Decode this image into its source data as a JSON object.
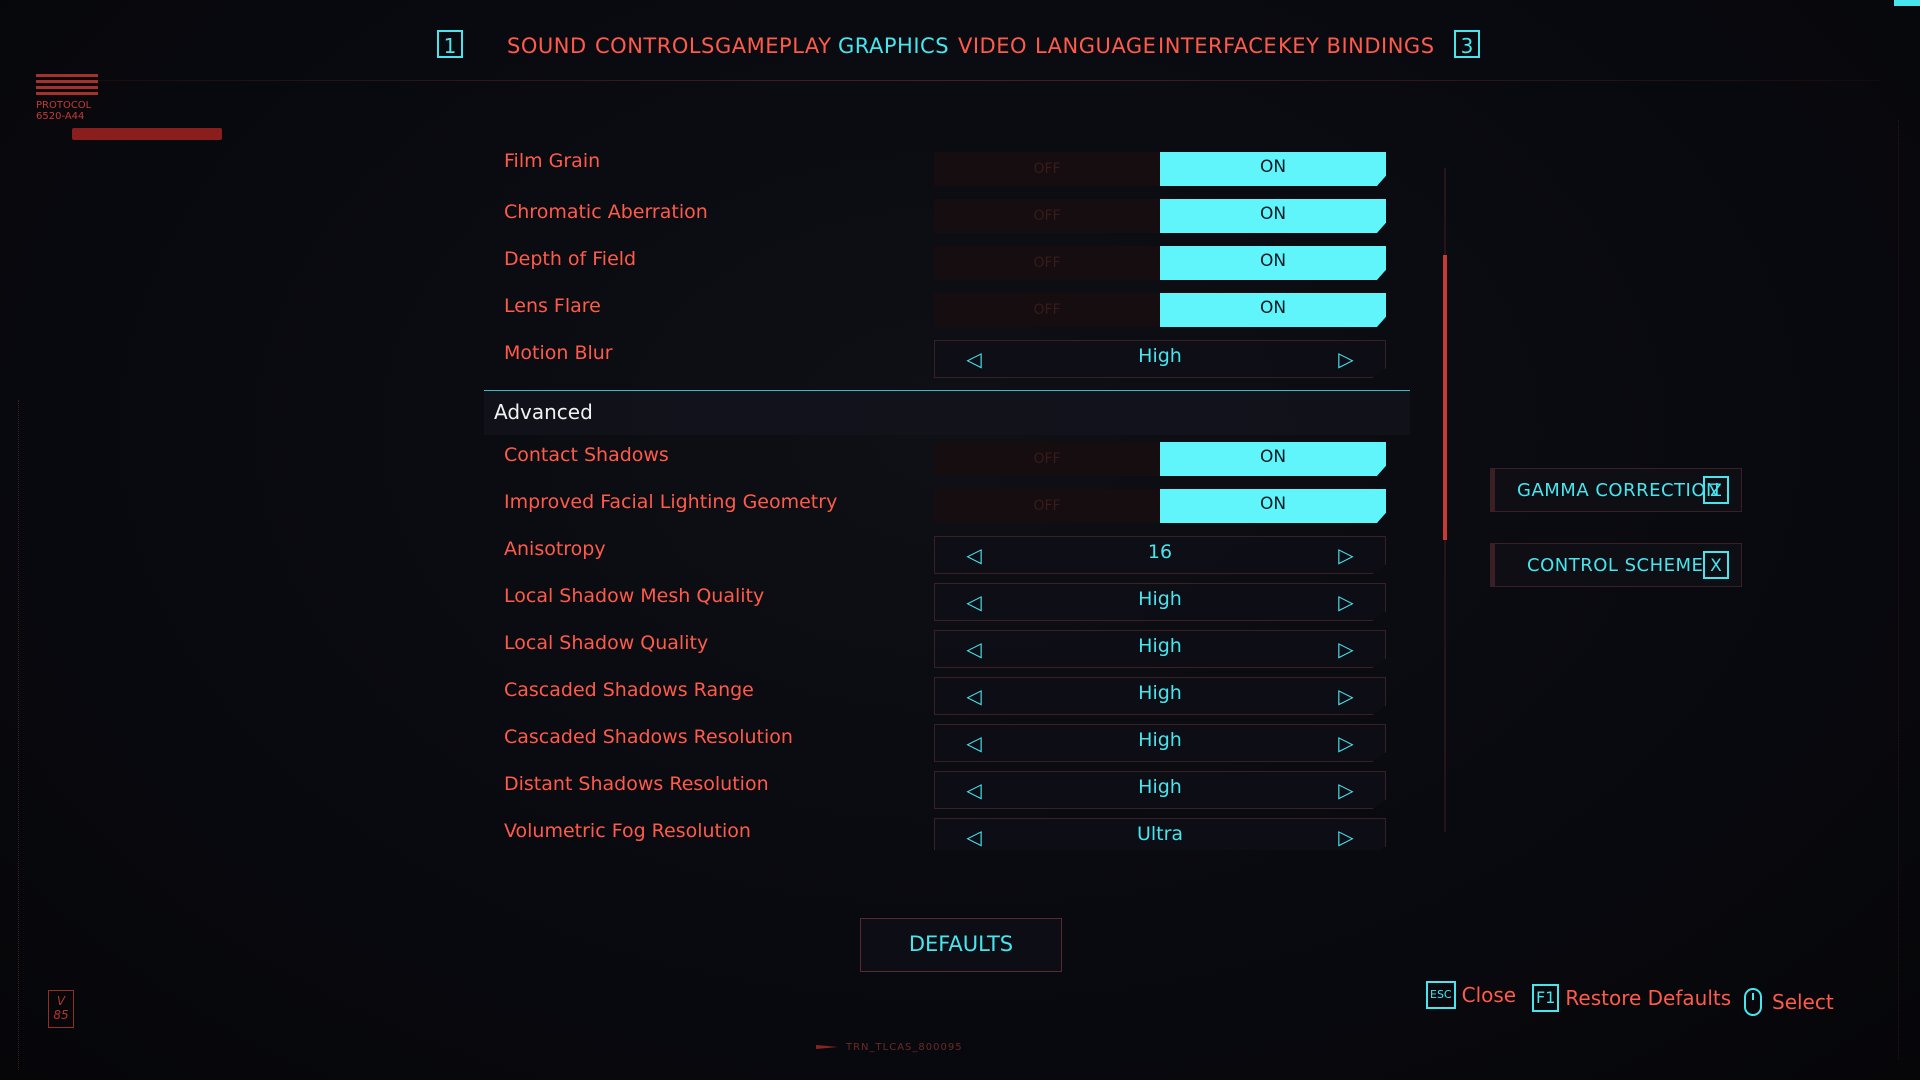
{
  "nav": {
    "prev_key": "1",
    "next_key": "3",
    "tabs": [
      {
        "label": "SOUND",
        "active": false
      },
      {
        "label": "CONTROLS",
        "active": false
      },
      {
        "label": "GAMEPLAY",
        "active": false
      },
      {
        "label": "GRAPHICS",
        "active": true
      },
      {
        "label": "VIDEO",
        "active": false
      },
      {
        "label": "LANGUAGE",
        "active": false
      },
      {
        "label": "INTERFACE",
        "active": false
      },
      {
        "label": "KEY BINDINGS",
        "active": false
      }
    ]
  },
  "logo": {
    "line1": "PROTOCOL",
    "line2": "6520-A44"
  },
  "settings": {
    "film_grain": {
      "label": "Film Grain",
      "off": "OFF",
      "on": "ON"
    },
    "chromatic_aberration": {
      "label": "Chromatic Aberration",
      "off": "OFF",
      "on": "ON"
    },
    "depth_of_field": {
      "label": "Depth of Field",
      "off": "OFF",
      "on": "ON"
    },
    "lens_flare": {
      "label": "Lens Flare",
      "off": "OFF",
      "on": "ON"
    },
    "motion_blur": {
      "label": "Motion Blur",
      "value": "High"
    },
    "advanced_title": "Advanced",
    "contact_shadows": {
      "label": "Contact Shadows",
      "off": "OFF",
      "on": "ON"
    },
    "improved_facial": {
      "label": "Improved Facial Lighting Geometry",
      "off": "OFF",
      "on": "ON"
    },
    "anisotropy": {
      "label": "Anisotropy",
      "value": "16"
    },
    "local_shadow_mesh": {
      "label": "Local Shadow Mesh Quality",
      "value": "High"
    },
    "local_shadow_quality": {
      "label": "Local Shadow Quality",
      "value": "High"
    },
    "cascaded_range": {
      "label": "Cascaded Shadows Range",
      "value": "High"
    },
    "cascaded_resolution": {
      "label": "Cascaded Shadows Resolution",
      "value": "High"
    },
    "distant_shadows": {
      "label": "Distant Shadows Resolution",
      "value": "High"
    },
    "volumetric_fog": {
      "label": "Volumetric Fog Resolution",
      "value": "Ultra"
    }
  },
  "side_buttons": {
    "gamma": {
      "label": "GAMMA CORRECTION",
      "key": "Z"
    },
    "control_scheme": {
      "label": "CONTROL SCHEME",
      "key": "X"
    }
  },
  "defaults_label": "DEFAULTS",
  "hints": {
    "close": {
      "key": "ESC",
      "label": "Close"
    },
    "restore": {
      "key": "F1",
      "label": "Restore Defaults"
    },
    "select": {
      "label": "Select"
    }
  },
  "badge": "V 85",
  "bottom_code": "TRN_TLCAS_800095",
  "colors": {
    "accent_cyan": "#47e6ee",
    "accent_red": "#ff5a4a",
    "toggle_on": "#5ff5fa"
  }
}
